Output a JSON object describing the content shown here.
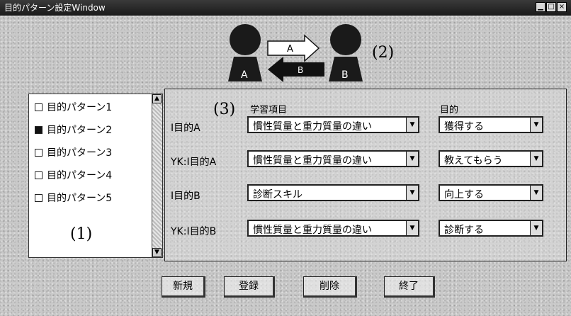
{
  "window": {
    "title": "目的パターン設定Window",
    "min_label": "▁",
    "max_label": "□",
    "close_label": "×"
  },
  "diagram": {
    "person_a": "A",
    "person_b": "B",
    "arrow_top": "A",
    "arrow_bottom": "B",
    "label": "(2)"
  },
  "pattern_list": {
    "label": "(1)",
    "items": [
      {
        "label": "目的パターン1",
        "checked": false
      },
      {
        "label": "目的パターン2",
        "checked": true
      },
      {
        "label": "目的パターン3",
        "checked": false
      },
      {
        "label": "目的パターン4",
        "checked": false
      },
      {
        "label": "目的パターン5",
        "checked": false
      }
    ]
  },
  "settings": {
    "label": "(3)",
    "header_item": "学習項目",
    "header_goal": "目的",
    "rows": [
      {
        "label": "I目的A",
        "item": "慣性質量と重力質量の違い",
        "goal": "獲得する"
      },
      {
        "label": "YK:I目的A",
        "item": "慣性質量と重力質量の違い",
        "goal": "教えてもらう"
      },
      {
        "label": "I目的B",
        "item": "診断スキル",
        "goal": "向上する"
      },
      {
        "label": "YK:I目的B",
        "item": "慣性質量と重力質量の違い",
        "goal": "診断する"
      }
    ]
  },
  "buttons": {
    "new": "新規",
    "register": "登録",
    "delete": "削除",
    "exit": "終了"
  }
}
